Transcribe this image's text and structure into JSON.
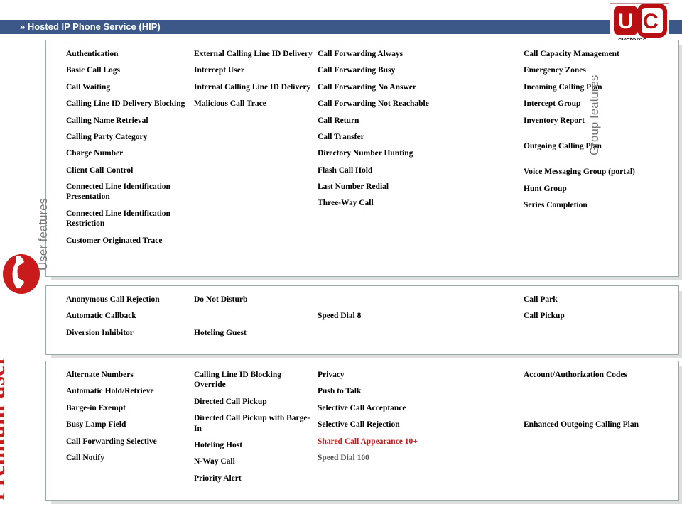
{
  "header": {
    "title": "» Hosted IP Phone Service (HIP)"
  },
  "rail": {
    "premium": "Premium user"
  },
  "labels": {
    "user": "User features",
    "group": "Group features"
  },
  "box1": {
    "c1": [
      "Authentication",
      "Basic Call Logs",
      "Call Waiting",
      "Calling Line ID Delivery Blocking",
      "Calling Name Retrieval",
      "Calling Party Category",
      "Charge Number",
      "Client Call Control",
      "Connected Line Identification Presentation",
      "Connected Line Identification Restriction",
      "Customer Originated Trace"
    ],
    "c2": [
      "External Calling Line ID Delivery",
      "Intercept User",
      "Internal Calling Line ID Delivery",
      "Malicious Call Trace"
    ],
    "c3": [
      "Call Forwarding Always",
      "Call Forwarding Busy",
      "Call Forwarding No Answer",
      "Call Forwarding Not Reachable",
      "Call Return",
      "Call Transfer",
      "Directory Number Hunting",
      "Flash Call Hold",
      "Last Number Redial",
      "Three-Way Call"
    ],
    "c5": [
      "Call Capacity Management",
      "Emergency Zones",
      "Incoming Calling Plan",
      "Intercept Group",
      "Inventory Report",
      "",
      "Outgoing Calling Plan",
      "",
      "Voice Messaging Group (portal)",
      "Hunt Group",
      "Series Completion"
    ]
  },
  "box2": {
    "c1": [
      "Anonymous Call Rejection",
      "Automatic Callback",
      "Diversion Inhibitor"
    ],
    "c2": [
      "Do Not Disturb",
      "",
      "Hoteling Guest"
    ],
    "c3": [
      "",
      "Speed Dial 8",
      ""
    ],
    "c5": [
      "Call Park",
      "Call Pickup"
    ]
  },
  "box3": {
    "c1": [
      "Alternate Numbers",
      "Automatic Hold/Retrieve",
      "Barge-in Exempt",
      "Busy Lamp Field",
      "Call Forwarding Selective",
      "Call Notify"
    ],
    "c2": [
      "Calling Line ID Blocking Override",
      "Directed Call Pickup",
      "Directed Call Pickup with Barge-In",
      "Hoteling Host",
      "N-Way Call",
      "Priority Alert"
    ],
    "c3": [
      "Privacy",
      "Push to Talk",
      "Selective Call Acceptance",
      "Selective Call Rejection",
      "Shared Call Appearance 10+",
      "Speed Dial 100"
    ],
    "c5": [
      "Account/Authorization Codes",
      "",
      "",
      "Enhanced Outgoing Calling Plan"
    ]
  },
  "special": {
    "shared": "Shared Call Appearance 10+",
    "sd100": "Speed Dial 100"
  }
}
